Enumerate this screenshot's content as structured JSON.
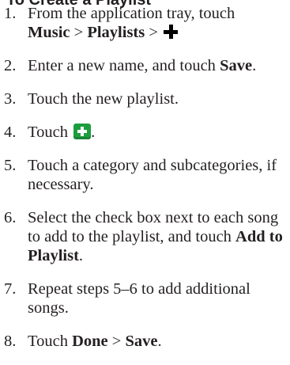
{
  "heading": "To Create a Playlist",
  "steps": [
    {
      "number": "1.",
      "text1": "From the application tray, touch",
      "music": "Music",
      "sep1": " > ",
      "playlists": "Playlists",
      "sep2": " > ",
      "icon": "plus-icon"
    },
    {
      "number": "2.",
      "text1": "Enter a new name, and touch ",
      "save": "Save",
      "end": "."
    },
    {
      "number": "3.",
      "text1": "Touch the new playlist."
    },
    {
      "number": "4.",
      "text1": "Touch ",
      "icon": "add-button-icon",
      "end": "."
    },
    {
      "number": "5.",
      "text1": "Touch a category and subcategories, if necessary."
    },
    {
      "number": "6.",
      "text1": "Select the check box next to each song to add to the playlist, and touch ",
      "add": "Add to Playlist",
      "end": "."
    },
    {
      "number": "7.",
      "text1": "Repeat steps 5–6 to add additional songs."
    },
    {
      "number": "8.",
      "text1": "Touch ",
      "done": "Done",
      "sep": " > ",
      "save": "Save",
      "end": "."
    }
  ],
  "colors": {
    "text": "#231f20",
    "add_button": "#1e9d3f"
  }
}
